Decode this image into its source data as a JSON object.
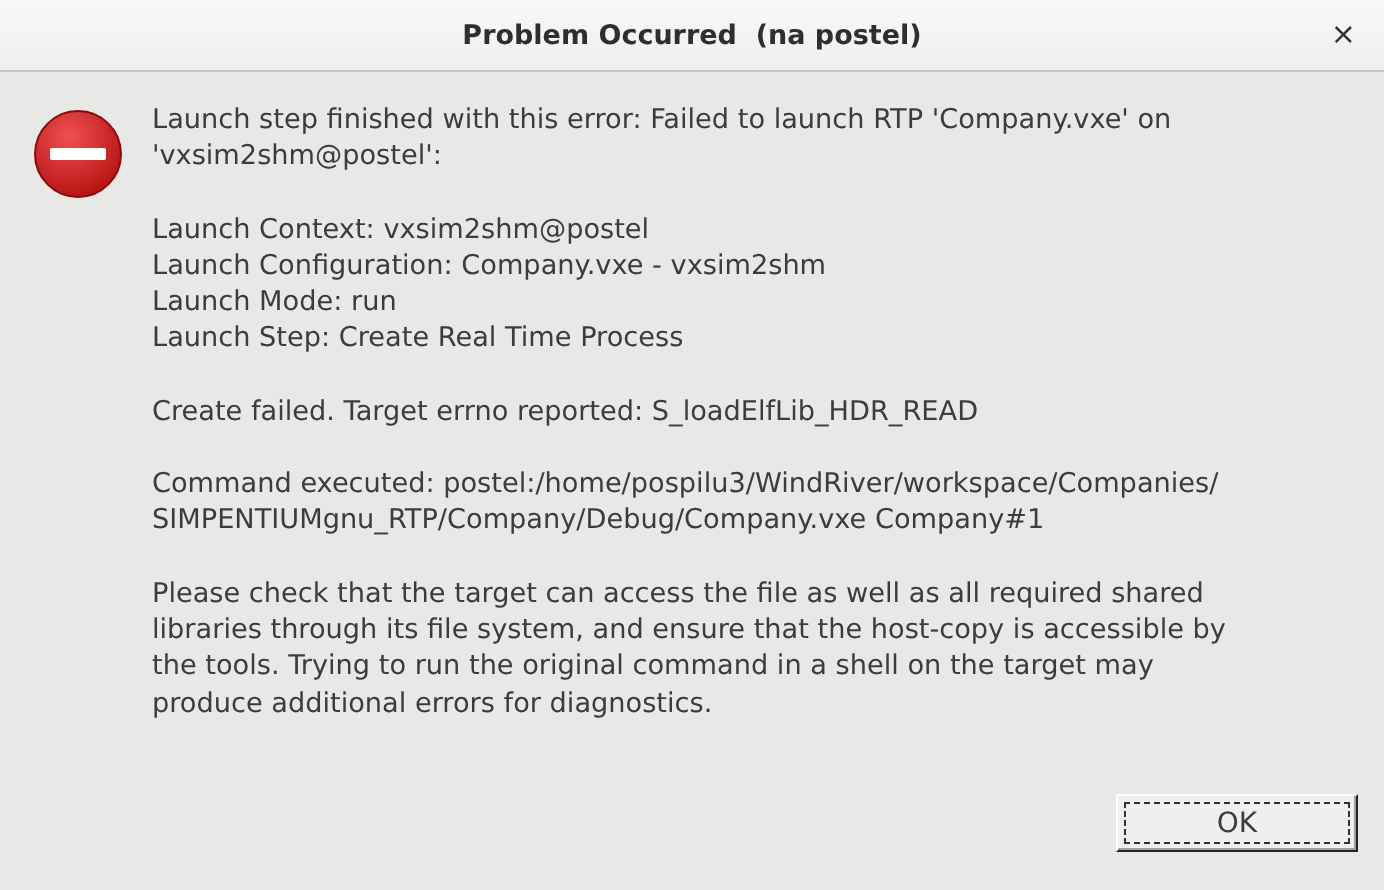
{
  "window": {
    "title": "Problem Occurred  (na postel)",
    "close": "×"
  },
  "paragraphs": [
    {
      "lines": [
        "Launch step finished with this error: Failed to launch RTP 'Company.vxe' on",
        "'vxsim2shm@postel':"
      ]
    },
    {
      "lines": [
        "Launch Context: vxsim2shm@postel",
        "Launch Configuration: Company.vxe - vxsim2shm",
        "Launch Mode: run",
        "Launch Step: Create Real Time Process"
      ]
    },
    {
      "lines": [
        "Create failed. Target errno reported: S_loadElfLib_HDR_READ"
      ]
    },
    {
      "lines": [
        "Command executed: postel:/home/pospilu3/WindRiver/workspace/Companies/",
        "SIMPENTIUMgnu_RTP/Company/Debug/Company.vxe Company#1"
      ]
    },
    {
      "lines": [
        "Please check that the target can access the file as well as all required shared",
        "libraries through its file system, and ensure that the host-copy is accessible by",
        "the tools. Trying to run the original command in a shell on the target may",
        "produce additional errors for diagnostics."
      ]
    }
  ],
  "buttons": [
    {
      "label": "OK",
      "focused": true
    }
  ]
}
